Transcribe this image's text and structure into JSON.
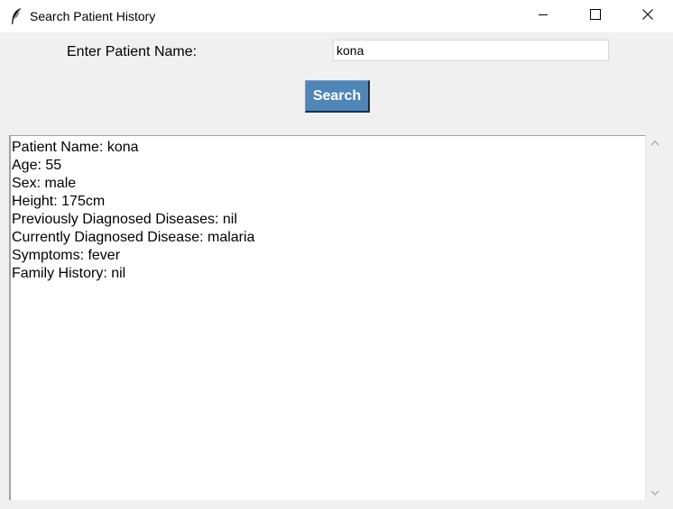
{
  "window": {
    "title": "Search Patient History",
    "icon": "feather-icon",
    "controls": [
      "minimize-icon",
      "maximize-icon",
      "close-icon"
    ]
  },
  "form": {
    "label": "Enter Patient Name:",
    "input_value": "kona",
    "search_label": "Search"
  },
  "results": {
    "lines": [
      "Patient Name: kona",
      "Age: 55",
      "Sex: male",
      "Height: 175cm",
      "Previously Diagnosed Diseases: nil",
      "Currently Diagnosed Disease: malaria",
      "Symptoms: fever",
      "Family History: nil"
    ]
  },
  "colors": {
    "button": "#4f86b8",
    "background": "#f0f0f0"
  }
}
